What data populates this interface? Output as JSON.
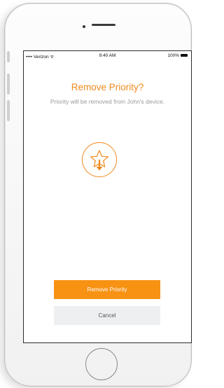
{
  "status_bar": {
    "carrier": "•••• Verizon ᯤ",
    "time": "9:40 AM",
    "battery": "100%"
  },
  "dialog": {
    "title": "Remove Priority?",
    "subtitle": "Priority will be removed from John's device.",
    "icon": "star-remove-icon",
    "accent_color": "#f08a1e"
  },
  "buttons": {
    "primary_label": "Remove Priority",
    "cancel_label": "Cancel"
  }
}
